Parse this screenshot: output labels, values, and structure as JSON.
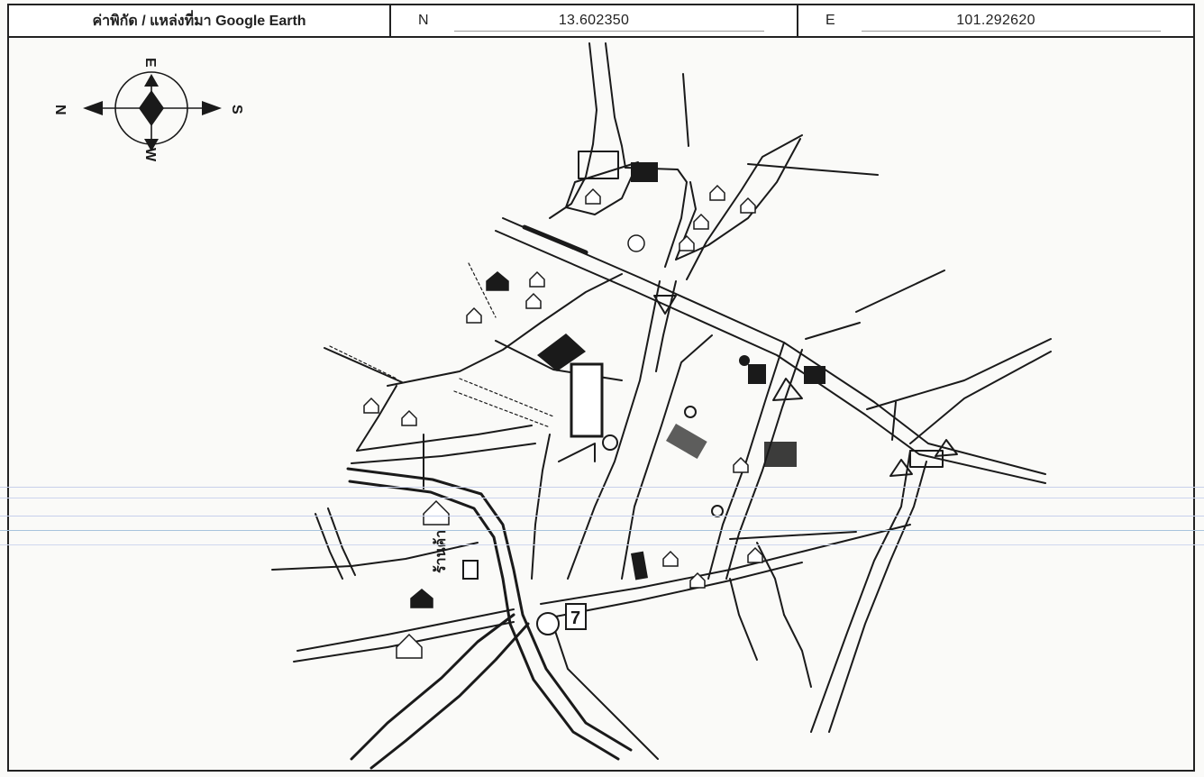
{
  "header": {
    "label": "ค่าพิกัด / แหล่งที่มา Google Earth",
    "n_letter": "N",
    "n_value": "13.602350",
    "e_letter": "E",
    "e_value": "101.292620"
  },
  "compass": {
    "n": "N",
    "s": "S",
    "e": "E",
    "w": "W"
  },
  "map_labels": {
    "shop": "ร้านค้า",
    "seven_eleven": "7"
  },
  "colors": {
    "ink": "#1a1a1a",
    "paper": "#fafaf8",
    "rule_blue": "#b9c6e6"
  }
}
